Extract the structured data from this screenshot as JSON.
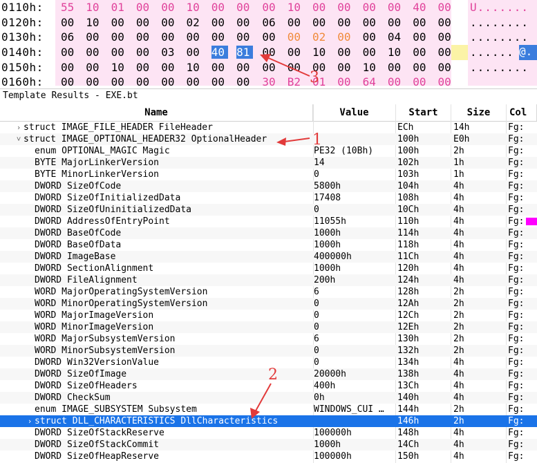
{
  "hex_view": {
    "rows": [
      {
        "addr": "0110h:",
        "bytes": [
          "55",
          "10",
          "01",
          "00",
          "00",
          "10",
          "00",
          "00",
          "00",
          "10",
          "00",
          "00",
          "00",
          "00",
          "40",
          "00"
        ],
        "ascii": "U......."
      },
      {
        "addr": "0120h:",
        "bytes": [
          "00",
          "10",
          "00",
          "00",
          "00",
          "02",
          "00",
          "00",
          "06",
          "00",
          "00",
          "00",
          "00",
          "00",
          "00",
          "00"
        ],
        "ascii": "........"
      },
      {
        "addr": "0130h:",
        "bytes": [
          "06",
          "00",
          "00",
          "00",
          "00",
          "00",
          "00",
          "00",
          "00",
          "00",
          "02",
          "00",
          "00",
          "04",
          "00",
          "00"
        ],
        "ascii": "........"
      },
      {
        "addr": "0140h:",
        "bytes": [
          "00",
          "00",
          "00",
          "00",
          "03",
          "00",
          "40",
          "81",
          "00",
          "00",
          "10",
          "00",
          "00",
          "10",
          "00",
          "00"
        ],
        "ascii": "......",
        "ascii_sel": "@."
      },
      {
        "addr": "0150h:",
        "bytes": [
          "00",
          "00",
          "10",
          "00",
          "00",
          "10",
          "00",
          "00",
          "00",
          "00",
          "00",
          "00",
          "10",
          "00",
          "00",
          "00"
        ],
        "ascii": "........"
      },
      {
        "addr": "0160h:",
        "bytes": [
          "00",
          "00",
          "00",
          "00",
          "00",
          "00",
          "00",
          "00",
          "30",
          "B2",
          "01",
          "00",
          "64",
          "00",
          "00",
          "00"
        ],
        "ascii": ""
      }
    ]
  },
  "template_results": {
    "title": "Template Results - EXE.bt",
    "columns": {
      "name": "Name",
      "value": "Value",
      "start": "Start",
      "size": "Size",
      "color": "Col"
    },
    "rows": [
      {
        "chev": ">",
        "indent": 0,
        "name": "struct IMAGE_FILE_HEADER FileHeader",
        "value": "",
        "start": "ECh",
        "size": "14h",
        "color": "Fg:"
      },
      {
        "chev": "v",
        "indent": 0,
        "name": "struct IMAGE_OPTIONAL_HEADER32 OptionalHeader",
        "value": "",
        "start": "100h",
        "size": "E0h",
        "color": "Fg:"
      },
      {
        "chev": "",
        "indent": 1,
        "name": "enum OPTIONAL_MAGIC Magic",
        "value": "PE32 (10Bh)",
        "start": "100h",
        "size": "2h",
        "color": "Fg:"
      },
      {
        "chev": "",
        "indent": 1,
        "name": "BYTE MajorLinkerVersion",
        "value": "14",
        "start": "102h",
        "size": "1h",
        "color": "Fg:"
      },
      {
        "chev": "",
        "indent": 1,
        "name": "BYTE MinorLinkerVersion",
        "value": "0",
        "start": "103h",
        "size": "1h",
        "color": "Fg:"
      },
      {
        "chev": "",
        "indent": 1,
        "name": "DWORD SizeOfCode",
        "value": "5800h",
        "start": "104h",
        "size": "4h",
        "color": "Fg:"
      },
      {
        "chev": "",
        "indent": 1,
        "name": "DWORD SizeOfInitializedData",
        "value": "17408",
        "start": "108h",
        "size": "4h",
        "color": "Fg:"
      },
      {
        "chev": "",
        "indent": 1,
        "name": "DWORD SizeOfUninitializedData",
        "value": "0",
        "start": "10Ch",
        "size": "4h",
        "color": "Fg:"
      },
      {
        "chev": "",
        "indent": 1,
        "name": "DWORD AddressOfEntryPoint",
        "value": "11055h",
        "start": "110h",
        "size": "4h",
        "color": "Fg:",
        "swatch": "#ff00ff"
      },
      {
        "chev": "",
        "indent": 1,
        "name": "DWORD BaseOfCode",
        "value": "1000h",
        "start": "114h",
        "size": "4h",
        "color": "Fg:"
      },
      {
        "chev": "",
        "indent": 1,
        "name": "DWORD BaseOfData",
        "value": "1000h",
        "start": "118h",
        "size": "4h",
        "color": "Fg:"
      },
      {
        "chev": "",
        "indent": 1,
        "name": "DWORD ImageBase",
        "value": "400000h",
        "start": "11Ch",
        "size": "4h",
        "color": "Fg:"
      },
      {
        "chev": "",
        "indent": 1,
        "name": "DWORD SectionAlignment",
        "value": "1000h",
        "start": "120h",
        "size": "4h",
        "color": "Fg:"
      },
      {
        "chev": "",
        "indent": 1,
        "name": "DWORD FileAlignment",
        "value": "200h",
        "start": "124h",
        "size": "4h",
        "color": "Fg:"
      },
      {
        "chev": "",
        "indent": 1,
        "name": "WORD MajorOperatingSystemVersion",
        "value": "6",
        "start": "128h",
        "size": "2h",
        "color": "Fg:"
      },
      {
        "chev": "",
        "indent": 1,
        "name": "WORD MinorOperatingSystemVersion",
        "value": "0",
        "start": "12Ah",
        "size": "2h",
        "color": "Fg:"
      },
      {
        "chev": "",
        "indent": 1,
        "name": "WORD MajorImageVersion",
        "value": "0",
        "start": "12Ch",
        "size": "2h",
        "color": "Fg:"
      },
      {
        "chev": "",
        "indent": 1,
        "name": "WORD MinorImageVersion",
        "value": "0",
        "start": "12Eh",
        "size": "2h",
        "color": "Fg:"
      },
      {
        "chev": "",
        "indent": 1,
        "name": "WORD MajorSubsystemVersion",
        "value": "6",
        "start": "130h",
        "size": "2h",
        "color": "Fg:"
      },
      {
        "chev": "",
        "indent": 1,
        "name": "WORD MinorSubsystemVersion",
        "value": "0",
        "start": "132h",
        "size": "2h",
        "color": "Fg:"
      },
      {
        "chev": "",
        "indent": 1,
        "name": "DWORD Win32VersionValue",
        "value": "0",
        "start": "134h",
        "size": "4h",
        "color": "Fg:"
      },
      {
        "chev": "",
        "indent": 1,
        "name": "DWORD SizeOfImage",
        "value": "20000h",
        "start": "138h",
        "size": "4h",
        "color": "Fg:"
      },
      {
        "chev": "",
        "indent": 1,
        "name": "DWORD SizeOfHeaders",
        "value": "400h",
        "start": "13Ch",
        "size": "4h",
        "color": "Fg:"
      },
      {
        "chev": "",
        "indent": 1,
        "name": "DWORD CheckSum",
        "value": "0h",
        "start": "140h",
        "size": "4h",
        "color": "Fg:"
      },
      {
        "chev": "",
        "indent": 1,
        "name": "enum IMAGE_SUBSYSTEM Subsystem",
        "value": "WINDOWS_CUI …",
        "start": "144h",
        "size": "2h",
        "color": "Fg:"
      },
      {
        "chev": ">",
        "indent": 1,
        "name": "struct DLL_CHARACTERISTICS DllCharacteristics",
        "value": "",
        "start": "146h",
        "size": "2h",
        "color": "Fg:",
        "selected": true
      },
      {
        "chev": "",
        "indent": 1,
        "name": "DWORD SizeOfStackReserve",
        "value": "100000h",
        "start": "148h",
        "size": "4h",
        "color": "Fg:"
      },
      {
        "chev": "",
        "indent": 1,
        "name": "DWORD SizeOfStackCommit",
        "value": "1000h",
        "start": "14Ch",
        "size": "4h",
        "color": "Fg:"
      },
      {
        "chev": "",
        "indent": 1,
        "name": "DWORD SizeOfHeapReserve",
        "value": "100000h",
        "start": "150h",
        "size": "4h",
        "color": "Fg:"
      }
    ]
  },
  "annotations": {
    "one": "1",
    "two": "2",
    "three": "3"
  },
  "colors": {
    "accent": "#1a73e8",
    "annotation": "#e23a3a",
    "hex_bg": "#fde4f4",
    "swatch": "#ff00ff"
  }
}
